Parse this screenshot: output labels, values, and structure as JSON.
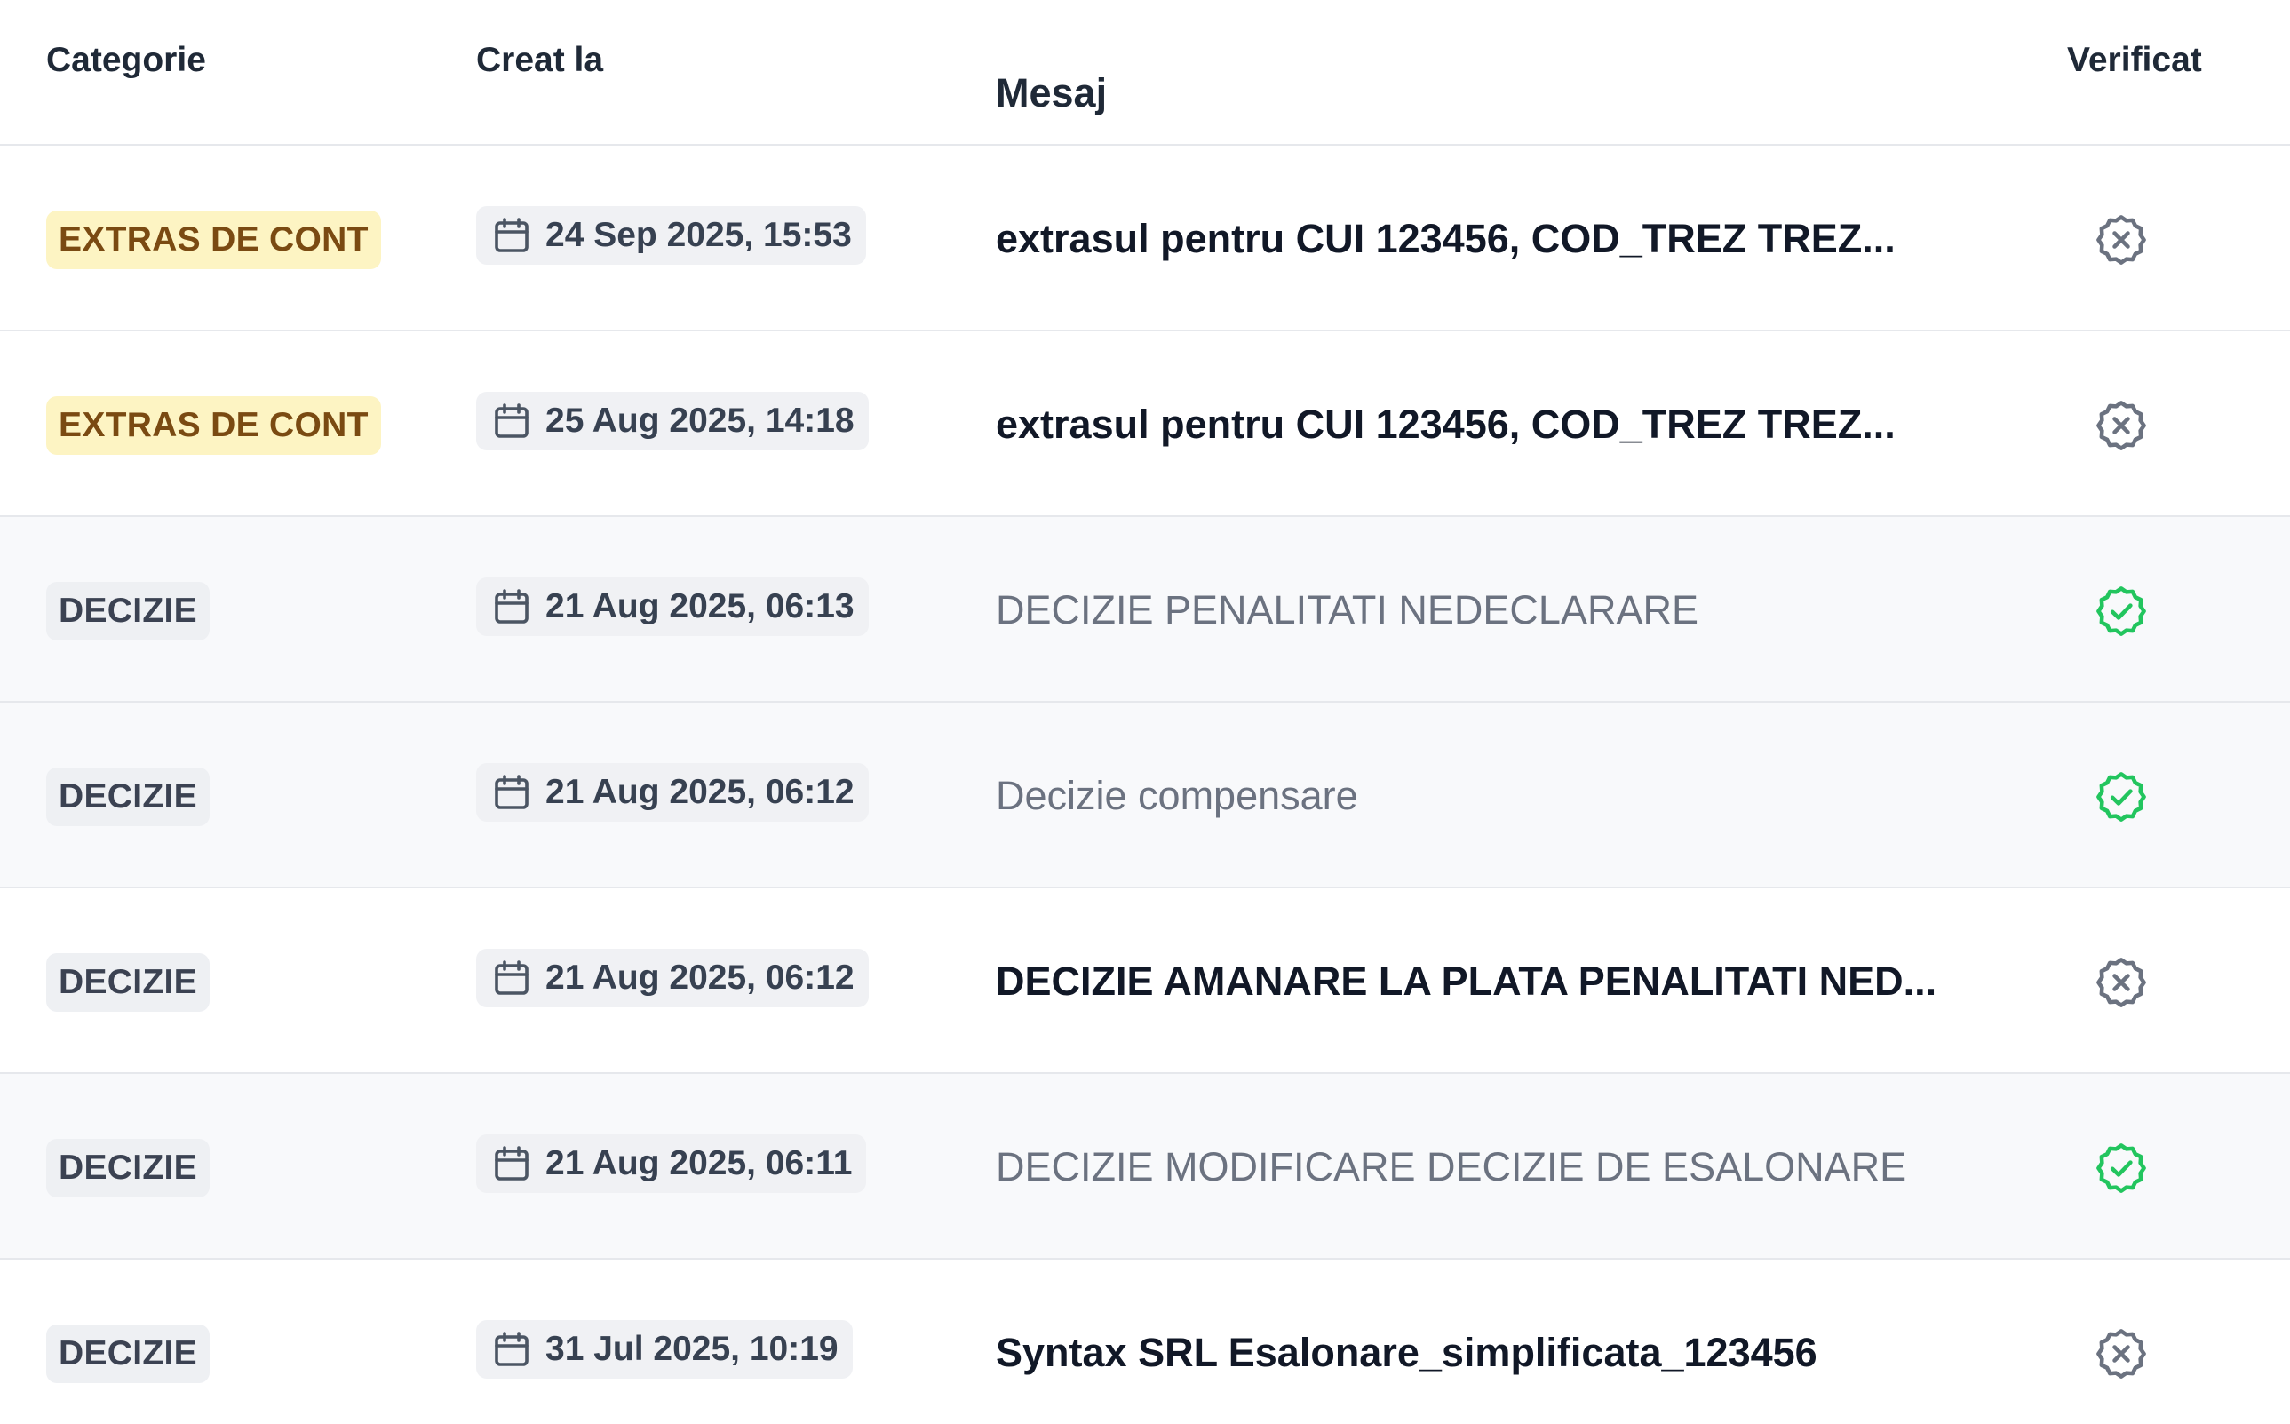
{
  "columns": {
    "category": "Categorie",
    "created": "Creat la",
    "message": "Mesaj",
    "verified": "Verificat"
  },
  "colors": {
    "extras_badge_bg": "#fdf4c3",
    "extras_badge_text": "#7a4a12",
    "decizie_badge_bg": "#eef0f3",
    "verified_green": "#22c55e",
    "unverified_gray": "#6b7280"
  },
  "rows": [
    {
      "category": "EXTRAS DE CONT",
      "category_type": "extras",
      "date": "24 Sep 2025, 15:53",
      "message": "extrasul pentru CUI 123456, COD_TREZ TREZ...",
      "verified": false,
      "read": false,
      "icon": "x-circle-icon"
    },
    {
      "category": "EXTRAS DE CONT",
      "category_type": "extras",
      "date": "25 Aug 2025, 14:18",
      "message": "extrasul pentru CUI 123456, COD_TREZ TREZ...",
      "verified": false,
      "read": false,
      "icon": "x-circle-icon"
    },
    {
      "category": "DECIZIE",
      "category_type": "decizie",
      "date": "21 Aug 2025, 06:13",
      "message": "DECIZIE PENALITATI NEDECLARARE",
      "verified": true,
      "read": true,
      "icon": "check-badge-icon"
    },
    {
      "category": "DECIZIE",
      "category_type": "decizie",
      "date": "21 Aug 2025, 06:12",
      "message": "Decizie compensare",
      "verified": true,
      "read": true,
      "icon": "check-badge-icon"
    },
    {
      "category": "DECIZIE",
      "category_type": "decizie",
      "date": "21 Aug 2025, 06:12",
      "message": "DECIZIE AMANARE LA PLATA PENALITATI NED...",
      "verified": false,
      "read": false,
      "icon": "x-circle-icon"
    },
    {
      "category": "DECIZIE",
      "category_type": "decizie",
      "date": "21 Aug 2025, 06:11",
      "message": "DECIZIE MODIFICARE DECIZIE DE ESALONARE",
      "verified": true,
      "read": true,
      "icon": "check-badge-icon"
    },
    {
      "category": "DECIZIE",
      "category_type": "decizie",
      "date": "31 Jul 2025, 10:19",
      "message": "Syntax SRL Esalonare_simplificata_123456",
      "verified": false,
      "read": false,
      "icon": "x-circle-icon"
    }
  ]
}
